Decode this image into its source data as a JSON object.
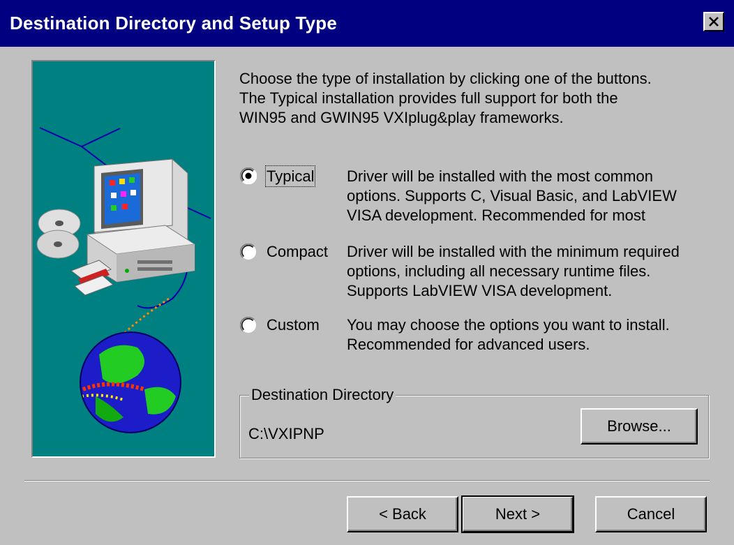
{
  "window": {
    "title": "Destination Directory and Setup Type",
    "close_icon": "close-icon"
  },
  "intro": {
    "line1": "Choose the type of installation by clicking one of the buttons.",
    "line2": "The Typical installation provides full support for both the",
    "line3": "WIN95 and GWIN95 VXIplug&play frameworks."
  },
  "options": [
    {
      "label": "Typical",
      "selected": true,
      "desc1": "Driver will be installed with the most common",
      "desc2": "options.  Supports C, Visual Basic, and LabVIEW",
      "desc3": "VISA development.  Recommended for most"
    },
    {
      "label": "Compact",
      "selected": false,
      "desc1": "Driver will be installed with the minimum required",
      "desc2": "options, including all necessary runtime files.",
      "desc3": "Supports LabVIEW VISA development."
    },
    {
      "label": "Custom",
      "selected": false,
      "desc1": "You may choose the options you want to install.",
      "desc2": "Recommended for advanced users."
    }
  ],
  "destination": {
    "group_label": "Destination Directory",
    "path": "C:\\VXIPNP",
    "browse_label": "Browse..."
  },
  "buttons": {
    "back_label": "< Back",
    "next_label": "Next >",
    "cancel_label": "Cancel"
  },
  "colors": {
    "titlebar": "#000080",
    "face": "#c0c0c0",
    "art_background": "#008080"
  }
}
